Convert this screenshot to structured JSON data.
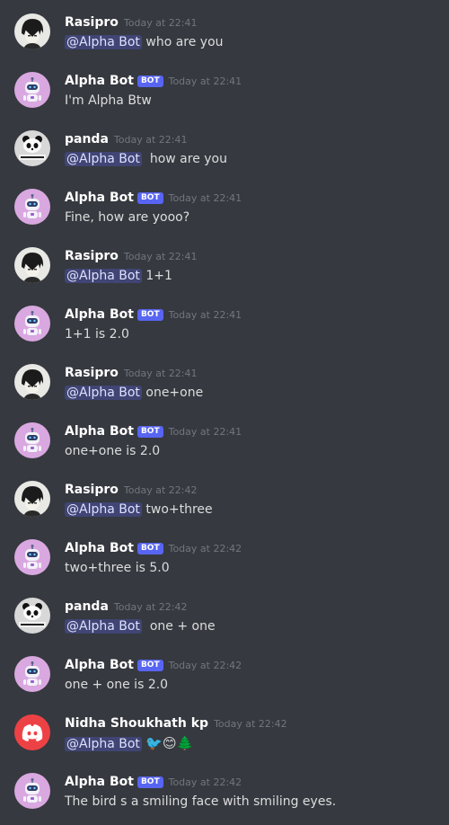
{
  "bot_tag": "BOT",
  "messages": [
    {
      "author": "Rasipro",
      "time": "Today at 22:41",
      "mention": "@Alpha Bot",
      "text": "who are you",
      "avatar": "anime"
    },
    {
      "author": "Alpha Bot",
      "bot": true,
      "time": "Today at 22:41",
      "text": "I'm Alpha Btw",
      "avatar": "robot"
    },
    {
      "author": "panda",
      "time": "Today at 22:41",
      "mention": "@Alpha Bot",
      "text": "how are you",
      "avatar": "panda"
    },
    {
      "author": "Alpha Bot",
      "bot": true,
      "time": "Today at 22:41",
      "text": "Fine, how are yooo?",
      "avatar": "robot"
    },
    {
      "author": "Rasipro",
      "time": "Today at 22:41",
      "mention": "@Alpha Bot",
      "text": "1+1",
      "avatar": "anime"
    },
    {
      "author": "Alpha Bot",
      "bot": true,
      "time": "Today at 22:41",
      "text": "1+1 is 2.0",
      "avatar": "robot"
    },
    {
      "author": "Rasipro",
      "time": "Today at 22:41",
      "mention": "@Alpha Bot",
      "text": "one+one",
      "avatar": "anime"
    },
    {
      "author": "Alpha Bot",
      "bot": true,
      "time": "Today at 22:41",
      "text": "one+one is 2.0",
      "avatar": "robot"
    },
    {
      "author": "Rasipro",
      "time": "Today at 22:42",
      "mention": "@Alpha Bot",
      "text": "two+three",
      "avatar": "anime"
    },
    {
      "author": "Alpha Bot",
      "bot": true,
      "time": "Today at 22:42",
      "text": "two+three is 5.0",
      "avatar": "robot"
    },
    {
      "author": "panda",
      "time": "Today at 22:42",
      "mention": "@Alpha Bot",
      "text": "one + one",
      "avatar": "panda"
    },
    {
      "author": "Alpha Bot",
      "bot": true,
      "time": "Today at 22:42",
      "text": "one + one is 2.0",
      "avatar": "robot"
    },
    {
      "author": "Nidha Shoukhath kp",
      "time": "Today at 22:42",
      "mention": "@Alpha Bot",
      "text": "🐦😊🌲",
      "avatar": "discord"
    },
    {
      "author": "Alpha Bot",
      "bot": true,
      "time": "Today at 22:42",
      "text": "The bird s a smiling face with smiling eyes.",
      "avatar": "robot"
    }
  ],
  "colors": {
    "background": "#36393f",
    "username": "#ffffff",
    "timestamp": "#72767d",
    "bot_tag": "#5865f2",
    "discord_avatar": "#ed4245",
    "robot_avatar": "#d9a8e0"
  }
}
